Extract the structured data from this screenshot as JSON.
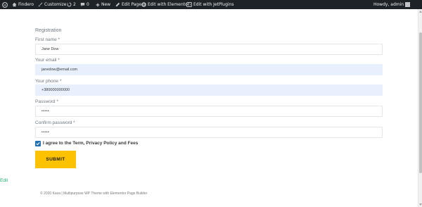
{
  "admin_bar": {
    "site_name": "Findero",
    "customize": "Customize",
    "updates_count": "2",
    "comments_count": "0",
    "new_label": "New",
    "edit_page": "Edit Page",
    "edit_elementor": "Edit with Elementor",
    "edit_jet": "Edit with JetPlugins",
    "howdy": "Howdy, admin",
    "icons": [
      "wordpress-icon",
      "home-icon",
      "paintbrush-icon",
      "updates-icon",
      "comment-icon",
      "plus-icon",
      "pencil-icon",
      "elementor-icon",
      "jetplugins-icon"
    ]
  },
  "form": {
    "title": "Registration",
    "first_name_label": "First name *",
    "first_name_value": "Jane Dow",
    "email_label": "Your email *",
    "email_value": "janedow@email.com",
    "phone_label": "Your phone *",
    "phone_value": "+380000000000",
    "password_label": "Password *",
    "password_value": "•••••",
    "confirm_label": "Confirm password *",
    "confirm_value": "•••••",
    "agree_label": "I agree to the Term, Privacy Policy and Fees",
    "submit_label": "SUBMIT"
  },
  "edit_link": "Edit",
  "footer": {
    "text": "© 2020 Kava | Multipurpose WP Theme with Elementor Page Builder"
  },
  "colors": {
    "admin_bar_bg": "#1d2327",
    "submit_bg": "#fcc200",
    "checkbox": "#2271b1",
    "edit_link": "#1eb26b",
    "autofill_bg": "#e8f0fe"
  }
}
